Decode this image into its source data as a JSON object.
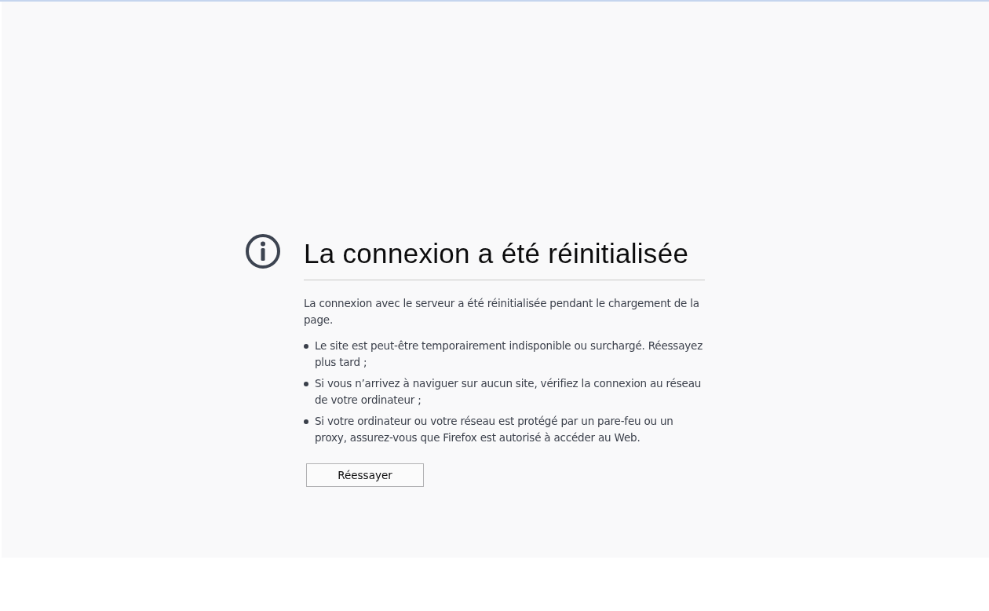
{
  "title": "La connexion a été réinitialisée",
  "description": "La connexion avec le serveur a été réinitialisée pendant le chargement de la page.",
  "suggestions": [
    "Le site est peut-être temporairement indisponible ou surchargé. Réessayez plus tard ;",
    "Si vous n’arrivez à naviguer sur aucun site, vérifiez la connexion au réseau de votre ordinateur ;",
    "Si votre ordinateur ou votre réseau est protégé par un pare-feu ou un proxy, assurez-vous que Firefox est autorisé à accéder au Web."
  ],
  "button": "Réessayer"
}
